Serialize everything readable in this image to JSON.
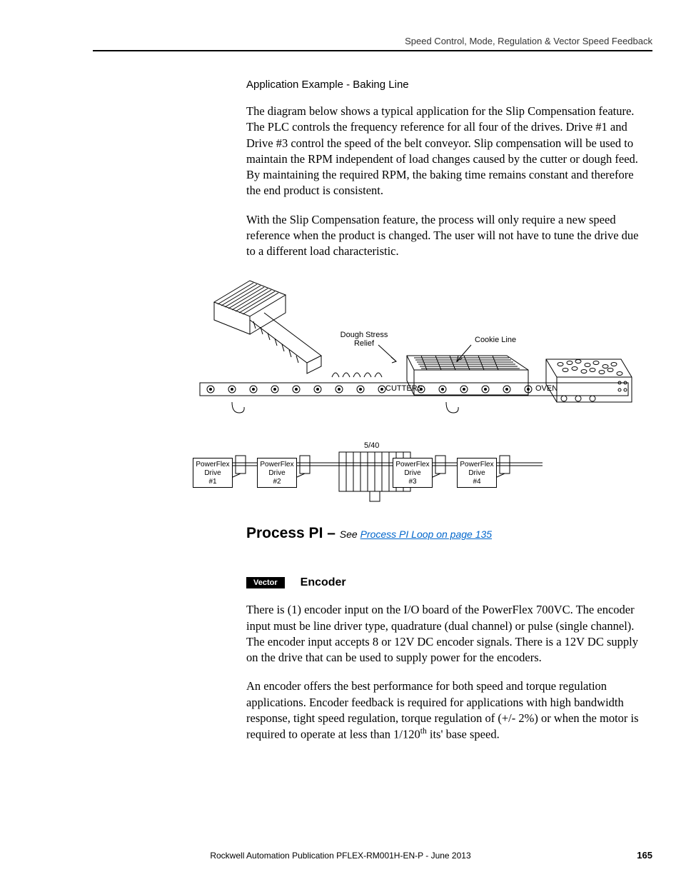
{
  "header": {
    "running_title": "Speed Control, Mode, Regulation & Vector Speed Feedback"
  },
  "section1": {
    "subheading": "Application Example - Baking Line",
    "para1": "The diagram below shows a typical application for the Slip Compensation feature. The PLC controls the frequency reference for all four of the drives. Drive #1 and Drive #3 control the speed of the belt conveyor. Slip compensation will be used to maintain the RPM independent of load changes caused by the cutter or dough feed. By maintaining the required RPM, the baking time remains constant and therefore the end product is consistent.",
    "para2": "With the Slip Compensation feature, the process will only require a new speed reference when the product is changed. The user will not have to tune the drive due to a different load characteristic."
  },
  "diagram": {
    "dough_stress": "Dough Stress Relief",
    "cookie_line": "Cookie Line",
    "cutters": "CUTTERS",
    "oven": "OVEN",
    "ratio": "5/40",
    "drive_prefix": "PowerFlex Drive",
    "drives": [
      "#1",
      "#2",
      "#3",
      "#4"
    ]
  },
  "section2": {
    "heading": "Process PI",
    "dash": " – ",
    "see_prefix": "See ",
    "link_text": "Process PI Loop on page 135"
  },
  "section3": {
    "badge": "Vector",
    "title": "Encoder",
    "para1": "There is (1) encoder input on the I/O board of the PowerFlex 700VC. The encoder input must be line driver type, quadrature (dual channel) or pulse (single channel). The encoder input accepts 8 or 12V DC encoder signals. There is a 12V DC supply on the drive that can be used to supply power for the encoders.",
    "para2_a": "An encoder offers the best performance for both speed and torque regulation applications. Encoder feedback is required for applications with high bandwidth response, tight speed regulation, torque regulation of (+/- 2%) or when the motor is required to operate at less than 1/120",
    "para2_sup": "th",
    "para2_b": " its' base speed."
  },
  "footer": {
    "publication": "Rockwell Automation Publication PFLEX-RM001H-EN-P - June 2013",
    "page": "165"
  }
}
